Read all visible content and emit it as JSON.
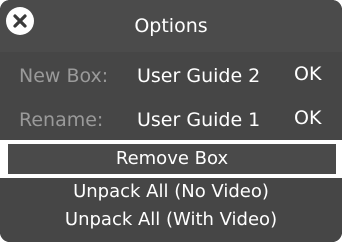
{
  "dialog": {
    "title": "Options",
    "close_icon": "close-icon"
  },
  "new_box": {
    "label": "New Box:",
    "value": "User Guide 2",
    "ok_label": "OK"
  },
  "rename": {
    "label": "Rename:",
    "value": "User Guide 1",
    "ok_label": "OK"
  },
  "actions": {
    "remove_box": "Remove Box",
    "unpack_no_video": "Unpack All (No Video)",
    "unpack_with_video": "Unpack All (With Video)"
  },
  "colors": {
    "panel_bg": "#464646",
    "header_bg": "#4b4b4b",
    "label_gray": "#9a9a9a",
    "selected_bg": "#ffffff"
  }
}
